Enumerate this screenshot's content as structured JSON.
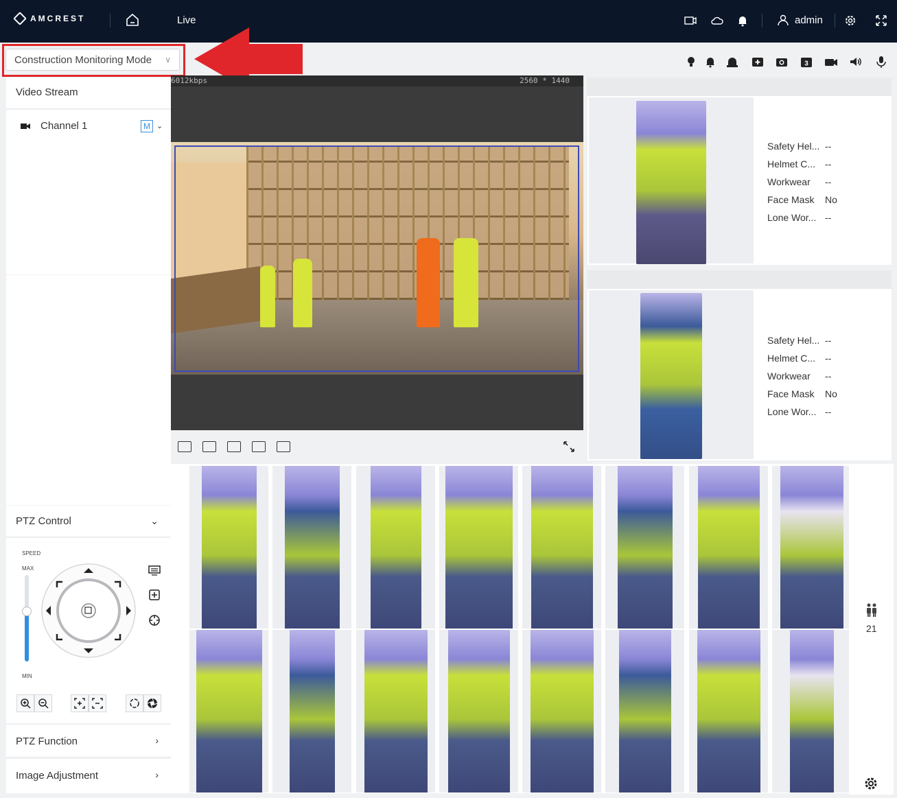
{
  "header": {
    "brand": "AMCREST",
    "nav_live": "Live",
    "user": "admin",
    "icons": [
      "camera-icon",
      "cloud-icon",
      "bell-icon",
      "user-icon",
      "gear-icon",
      "fullscreen-icon"
    ]
  },
  "mode_selector": {
    "value": "Construction Monitoring Mode"
  },
  "toolbar_icons": [
    "bulb-icon",
    "bell-icon",
    "alarm-icon",
    "add-icon",
    "snapshot-icon",
    "triple-snapshot-icon",
    "record-icon",
    "speaker-icon",
    "mic-icon"
  ],
  "toolbar_triple_label": "3",
  "left_panel": {
    "video_stream": "Video Stream",
    "channel": "Channel 1",
    "stream_badge": "M",
    "ptz_control": "PTZ Control",
    "speed_label": "SPEED",
    "max_label": "MAX",
    "min_label": "MIN",
    "ptz_function": "PTZ Function",
    "image_adjustment": "Image Adjustment"
  },
  "video": {
    "bitrate": "6012kbps",
    "resolution": "2560 * 1440"
  },
  "detections": [
    {
      "attributes": [
        {
          "name": "Safety Hel...",
          "value": "--"
        },
        {
          "name": "Helmet C...",
          "value": "--"
        },
        {
          "name": "Workwear",
          "value": "--"
        },
        {
          "name": "Face Mask",
          "value": "No"
        },
        {
          "name": "Lone Wor...",
          "value": "--"
        }
      ]
    },
    {
      "attributes": [
        {
          "name": "Safety Hel...",
          "value": "--"
        },
        {
          "name": "Helmet C...",
          "value": "--"
        },
        {
          "name": "Workwear",
          "value": "--"
        },
        {
          "name": "Face Mask",
          "value": "No"
        },
        {
          "name": "Lone Wor...",
          "value": "--"
        }
      ]
    }
  ],
  "people_count": "21",
  "colors": {
    "topbar": "#0b1628",
    "accent": "#2f8fde",
    "detection_box": "#3f49b8",
    "highlight": "#e0262a"
  }
}
